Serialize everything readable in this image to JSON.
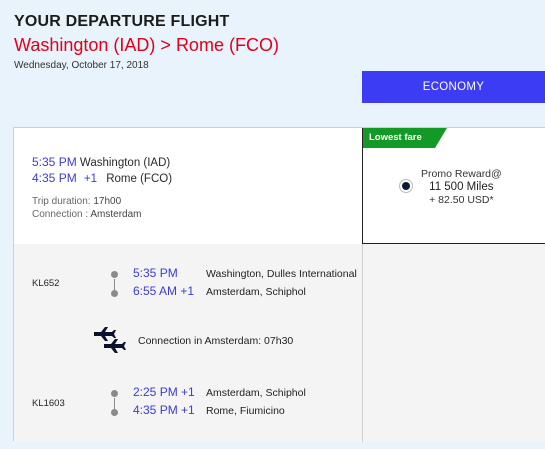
{
  "header": {
    "title": "YOUR DEPARTURE FLIGHT",
    "route_from": "Washington (IAD)",
    "route_sep": ">",
    "route_to": "Rome (FCO)",
    "date": "Wednesday, October 17, 2018"
  },
  "cabin_tab": {
    "label": "ECONOMY",
    "color": "#3c3cf4"
  },
  "summary": {
    "depart_time": "5:35 PM",
    "depart_city": "Washington (IAD)",
    "arrive_time": "4:35 PM",
    "arrive_plus": "+1",
    "arrive_city": "Rome (FCO)",
    "duration_label": "Trip duration:",
    "duration_value": "17h00",
    "connection_label": "Connection :",
    "connection_value": "Amsterdam"
  },
  "fare": {
    "tag": "Lowest fare",
    "tag_color": "#139a26",
    "name": "Promo Reward@",
    "miles": "11 500 Miles",
    "taxes": "+ 82.50 USD*",
    "selected": true
  },
  "segments": [
    {
      "flight": "KL652",
      "dep_time": "5:35 PM",
      "dep_plus": "",
      "dep_place": "Washington, Dulles International",
      "arr_time": "6:55 AM",
      "arr_plus": "+1",
      "arr_place": "Amsterdam, Schiphol"
    },
    {
      "flight": "KL1603",
      "dep_time": "2:25 PM",
      "dep_plus": "+1",
      "dep_place": "Amsterdam, Schiphol",
      "arr_time": "4:35 PM",
      "arr_plus": "+1",
      "arr_place": "Rome, Fiumicino"
    }
  ],
  "connection": {
    "text": "Connection in Amsterdam: 07h30",
    "icon": "connecting-flight-icon"
  }
}
